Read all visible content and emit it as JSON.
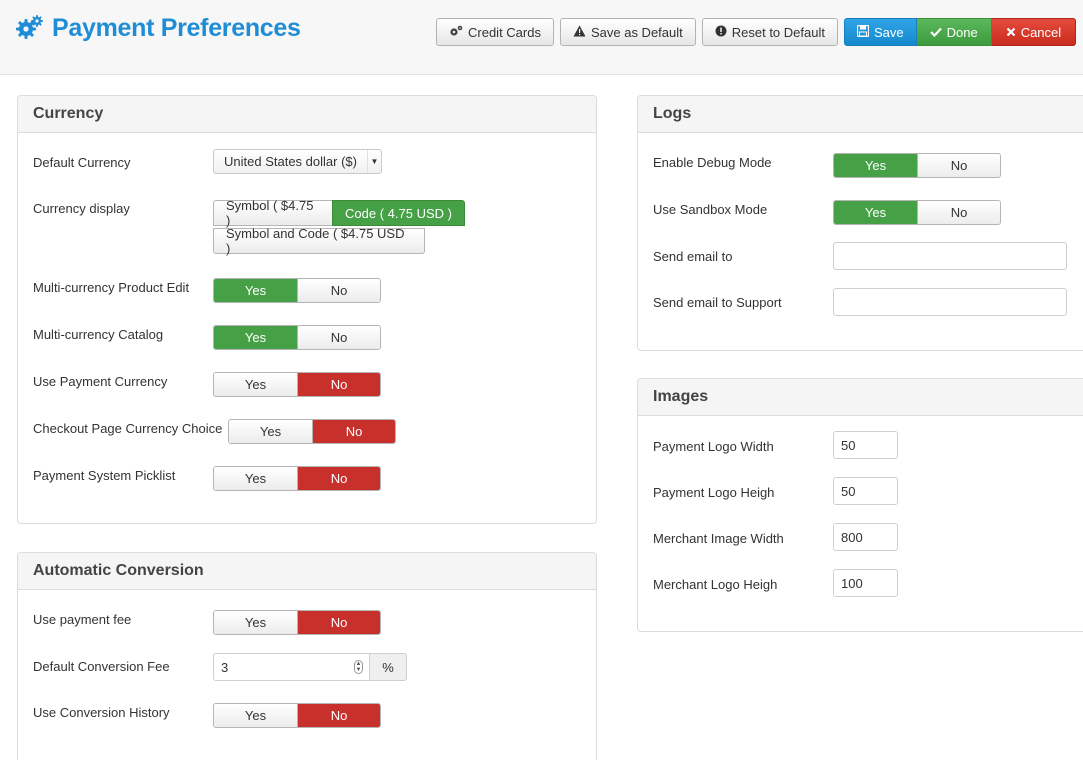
{
  "page": {
    "title": "Payment Preferences"
  },
  "toolbar": {
    "credit_cards": "Credit Cards",
    "save_default": "Save as Default",
    "reset_default": "Reset to Default",
    "save": "Save",
    "done": "Done",
    "cancel": "Cancel"
  },
  "currency": {
    "title": "Currency",
    "default_currency_label": "Default Currency",
    "default_currency_value": "United States dollar ($)",
    "display_label": "Currency display",
    "display_options": [
      "Symbol ( $4.75 )",
      "Code ( 4.75 USD )",
      "Symbol and Code ( $4.75 USD )"
    ],
    "display_selected": "Code ( 4.75 USD )",
    "multi_product_label": "Multi-currency Product Edit",
    "multi_catalog_label": "Multi-currency Catalog",
    "use_payment_label": "Use Payment Currency",
    "checkout_choice_label": "Checkout Page Currency Choice",
    "picklist_label": "Payment System Picklist"
  },
  "conversion": {
    "title": "Automatic Conversion",
    "fee_label": "Use payment fee",
    "default_fee_label": "Default Conversion Fee",
    "default_fee_value": "3",
    "fee_unit": "%",
    "history_label": "Use Conversion History"
  },
  "logs": {
    "title": "Logs",
    "debug_label": "Enable Debug Mode",
    "sandbox_label": "Use Sandbox Mode",
    "email_label": "Send email to",
    "email_value": "",
    "support_label": "Send email to Support",
    "support_value": ""
  },
  "images": {
    "title": "Images",
    "logo_width_label": "Payment Logo Width",
    "logo_width_value": "50",
    "logo_height_label": "Payment Logo Heigh",
    "logo_height_value": "50",
    "merchant_width_label": "Merchant Image Width",
    "merchant_width_value": "800",
    "merchant_height_label": "Merchant Logo Heigh",
    "merchant_height_value": "100"
  },
  "toggle": {
    "yes": "Yes",
    "no": "No"
  },
  "toggle_states": {
    "multi_product": "Yes",
    "multi_catalog": "Yes",
    "use_payment": "No",
    "checkout_choice": "No",
    "picklist": "No",
    "fee": "No",
    "history": "No",
    "debug": "Yes",
    "sandbox": "Yes"
  },
  "icons": {
    "title": "gears-icon",
    "credit_cards": "gears-icon",
    "save_default": "warning-icon",
    "reset_default": "info-icon",
    "save": "floppy-icon",
    "done": "check-icon",
    "cancel": "close-icon"
  },
  "colors": {
    "brand": "#1f8dd6",
    "yes_active": "#46a046",
    "no_active": "#c8302b",
    "save": "#2fa4e7",
    "done": "#5cb85c",
    "cancel": "#e54b3c"
  }
}
